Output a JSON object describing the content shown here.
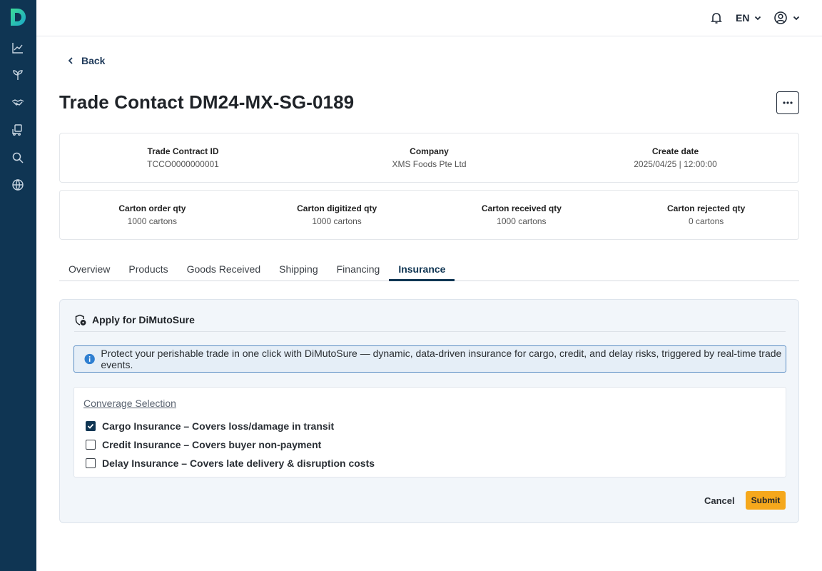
{
  "topbar": {
    "language": "EN"
  },
  "nav": {
    "back_label": "Back"
  },
  "page": {
    "title": "Trade Contact DM24-MX-SG-0189"
  },
  "summary": [
    {
      "label": "Trade Contract ID",
      "value": "TCCO0000000001"
    },
    {
      "label": "Company",
      "value": "XMS Foods Pte Ltd"
    },
    {
      "label": "Create date",
      "value": "2025/04/25 | 12:00:00"
    }
  ],
  "quantities": [
    {
      "label": "Carton order qty",
      "value": "1000 cartons"
    },
    {
      "label": "Carton digitized qty",
      "value": "1000 cartons"
    },
    {
      "label": "Carton received qty",
      "value": "1000 cartons"
    },
    {
      "label": "Carton rejected qty",
      "value": "0 cartons"
    }
  ],
  "tabs": [
    "Overview",
    "Products",
    "Goods Received",
    "Shipping",
    "Financing",
    "Insurance"
  ],
  "active_tab": "Insurance",
  "insurance": {
    "heading": "Apply for DiMutoSure",
    "info": "Protect your perishable trade in one click with DiMutoSure — dynamic, data-driven insurance for cargo, credit, and delay risks, triggered by real-time trade events.",
    "coverage_title": "Converage Selection",
    "options": [
      {
        "label": "Cargo Insurance – Covers loss/damage in transit",
        "checked": true
      },
      {
        "label": "Credit Insurance – Covers buyer non-payment",
        "checked": false
      },
      {
        "label": "Delay Insurance – Covers late delivery & disruption costs",
        "checked": false
      }
    ],
    "cancel_label": "Cancel",
    "submit_label": "Submit"
  },
  "colors": {
    "sidebar": "#0f3553",
    "accent": "#f5a81c",
    "info": "#2f7fd1"
  },
  "icons": [
    "logo-icon",
    "chart-icon",
    "plant-icon",
    "handshake-icon",
    "truck-icon",
    "search-icon",
    "globe-icon",
    "bell-icon",
    "chevron-down-icon",
    "user-icon",
    "chevron-left-icon",
    "more-icon",
    "shield-icon",
    "info-icon",
    "check-icon"
  ]
}
